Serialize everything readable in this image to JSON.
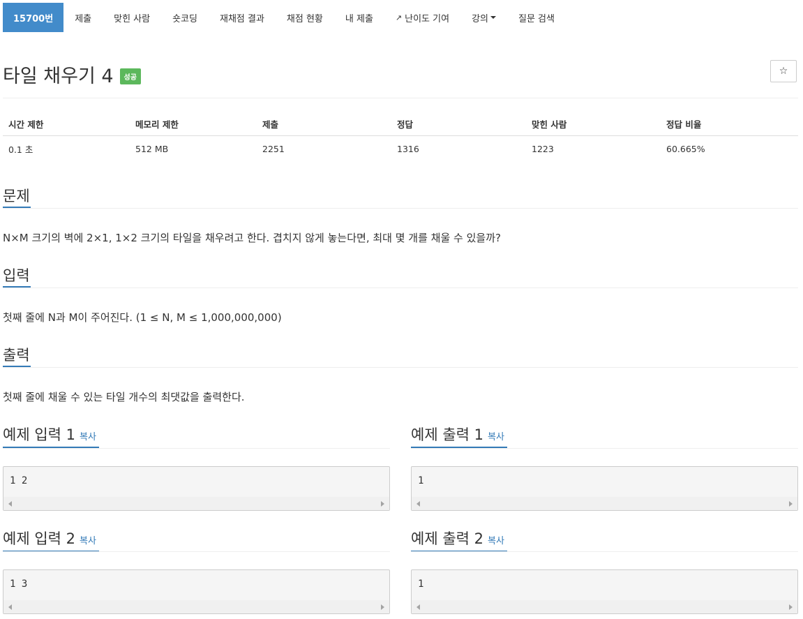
{
  "nav": {
    "items": [
      {
        "label": "15700번",
        "active": true
      },
      {
        "label": "제출"
      },
      {
        "label": "맞힌 사람"
      },
      {
        "label": "숏코딩"
      },
      {
        "label": "재채점 결과"
      },
      {
        "label": "채점 현황"
      },
      {
        "label": "내 제출"
      },
      {
        "label": "난이도 기여",
        "icon": "external-link-icon"
      },
      {
        "label": "강의",
        "icon": "caret-down-icon"
      },
      {
        "label": "질문 검색"
      }
    ]
  },
  "problem": {
    "title": "타일 채우기 4",
    "badge": "성공",
    "star_glyph": "☆"
  },
  "info": {
    "headers": [
      "시간 제한",
      "메모리 제한",
      "제출",
      "정답",
      "맞힌 사람",
      "정답 비율"
    ],
    "values": [
      "0.1 초",
      "512 MB",
      "2251",
      "1316",
      "1223",
      "60.665%"
    ]
  },
  "sections": {
    "problem_heading": "문제",
    "problem_text": "N×M 크기의 벽에 2×1, 1×2 크기의 타일을 채우려고 한다. 겹치지 않게 놓는다면, 최대 몇 개를 채울 수 있을까?",
    "input_heading": "입력",
    "input_text": "첫째 줄에 N과 M이 주어진다. (1 ≤ N, M ≤ 1,000,000,000)",
    "output_heading": "출력",
    "output_text": "첫째 줄에 채울 수 있는 타일 개수의 최댓값을 출력한다."
  },
  "examples": {
    "copy_label": "복사",
    "in1_title": "예제 입력 1",
    "in1_code": "1 2",
    "out1_title": "예제 출력 1",
    "out1_code": "1",
    "in2_title": "예제 입력 2",
    "in2_code": "1 3",
    "out2_title": "예제 출력 2",
    "out2_code": "1"
  },
  "colors": {
    "accent": "#428bca",
    "success": "#5cb85c",
    "link": "#337ab7"
  }
}
